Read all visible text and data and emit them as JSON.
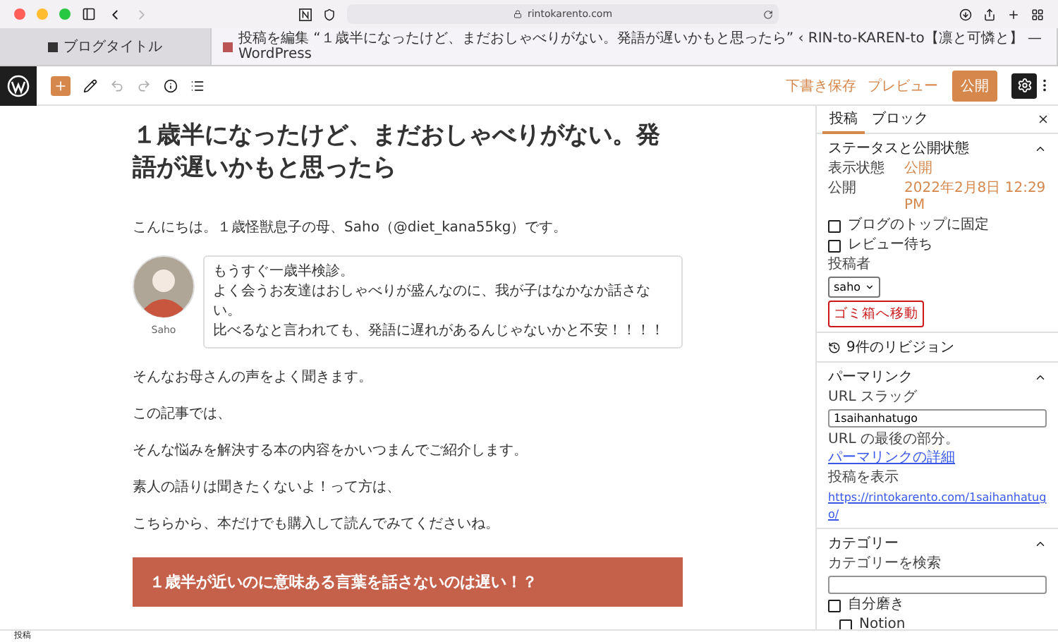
{
  "browser": {
    "url": "rintokarento.com",
    "tabs": [
      {
        "title": "ブログタイトル",
        "selected": false
      },
      {
        "title": "投稿を編集 “１歳半になったけど、まだおしゃべりがない。発語が遅いかもと思ったら” ‹ RIN-to-KAREN-to【凛と可憐と】 — WordPress",
        "selected": true
      }
    ]
  },
  "toolbar": {
    "save_draft": "下書き保存",
    "preview": "プレビュー",
    "publish": "公開"
  },
  "post": {
    "title": "１歳半になったけど、まだおしゃべりがない。発語が遅いかもと思ったら",
    "blocks": [
      {
        "kind": "paragraph",
        "text": "こんにちは。１歳怪獣息子の母、Saho（@diet_kana55kg）です。"
      },
      {
        "kind": "speech",
        "name": "Saho",
        "lines": [
          "もうすぐ一歳半検診。",
          "よく会うお友達はおしゃべりが盛んなのに、我が子はなかなか話さない。",
          "比べるなと言われても、発語に遅れがあるんじゃないかと不安！！！！"
        ]
      },
      {
        "kind": "paragraph",
        "text": "そんなお母さんの声をよく聞きます。"
      },
      {
        "kind": "paragraph",
        "text": "この記事では、"
      },
      {
        "kind": "paragraph",
        "text": "そんな悩みを解決する本の内容をかいつまんでご紹介します。"
      },
      {
        "kind": "paragraph",
        "text": "素人の語りは聞きたくないよ！って方は、"
      },
      {
        "kind": "paragraph",
        "text": "こちらから、本だけでも購入して読んでみてくださいね。"
      },
      {
        "kind": "heading",
        "text": "１歳半が近いのに意味ある言葉を話さないのは遅い！？"
      }
    ]
  },
  "sidebar": {
    "tabs": [
      {
        "label": "投稿",
        "selected": true
      },
      {
        "label": "ブロック",
        "selected": false
      }
    ],
    "status_panel": {
      "title": "ステータスと公開状態",
      "expanded": true,
      "rows": [
        {
          "label": "表示状態",
          "value": "公開"
        },
        {
          "label": "公開",
          "value": "2022年2月8日 12:29 PM"
        }
      ],
      "options": [
        {
          "label": "ブログのトップに固定",
          "checked": false
        },
        {
          "label": "レビュー待ち",
          "checked": false
        }
      ],
      "author_label": "投稿者",
      "author": "saho",
      "trash": "ゴミ箱へ移動"
    },
    "revisions": "9件のリビジョン",
    "permalink": {
      "title": "パーマリンク",
      "expanded": true,
      "slug_label": "URL スラッグ",
      "slug": "1saihanhatugo",
      "hint": "URL の最後の部分。",
      "hint_link": "パーマリンクの詳細",
      "view_label": "投稿を表示",
      "url": "https://rintokarento.com/1saihanhatugo/"
    },
    "categories": {
      "title": "カテゴリー",
      "expanded": true,
      "search_label": "カテゴリーを検索",
      "items": [
        {
          "label": "自分磨き",
          "checked": false,
          "children": [
            {
              "label": "Notion",
              "checked": false
            }
          ]
        }
      ]
    }
  },
  "status_bar": "投稿"
}
